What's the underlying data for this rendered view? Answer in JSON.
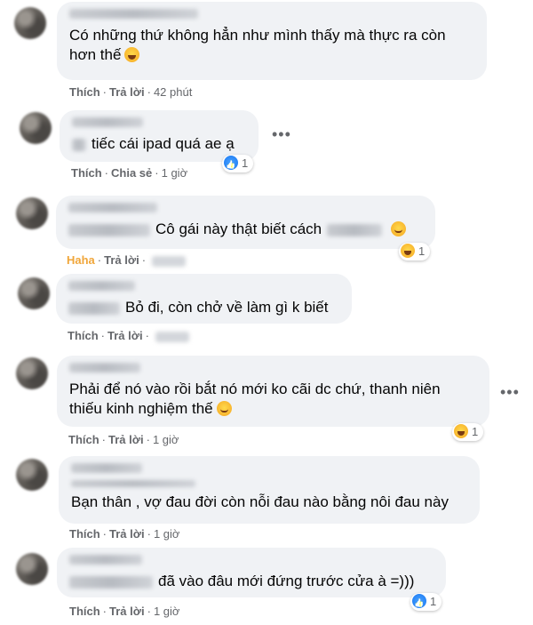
{
  "comments": [
    {
      "text": "Có những thứ không hẳn như mình thấy mà thực ra còn",
      "text2": "hơn thế",
      "actions": {
        "like": "Thích",
        "reply": "Trả lời",
        "time": "42 phút"
      }
    },
    {
      "text": "tiếc cái ipad quá ae ạ",
      "actions": {
        "like": "Thích",
        "share": "Chia sẻ",
        "time": "1 giờ"
      },
      "reaction_count": "1"
    },
    {
      "text": "Cô gái này thật biết cách",
      "actions": {
        "haha": "Haha",
        "reply": "Trả lời"
      },
      "reaction_count": "1"
    },
    {
      "text": "Bỏ đi, còn chở về làm gì k biết",
      "actions": {
        "like": "Thích",
        "reply": "Trả lời"
      }
    },
    {
      "text": "Phải để nó vào rồi bắt nó mới ko cãi dc chứ, thanh niên",
      "text2": "thiếu kinh nghiệm thế",
      "actions": {
        "like": "Thích",
        "reply": "Trả lời",
        "time": "1 giờ"
      },
      "reaction_count": "1"
    },
    {
      "text": "Bạn thân , vợ đau đời còn nỗi đau nào bằng nôi đau này",
      "actions": {
        "like": "Thích",
        "reply": "Trả lời",
        "time": "1 giờ"
      }
    },
    {
      "text": "đã vào đâu mới đứng trước cửa à =)))",
      "actions": {
        "like": "Thích",
        "reply": "Trả lời",
        "time": "1 giờ"
      },
      "reaction_count": "1"
    }
  ],
  "separator": "·",
  "more_icon": "•••"
}
